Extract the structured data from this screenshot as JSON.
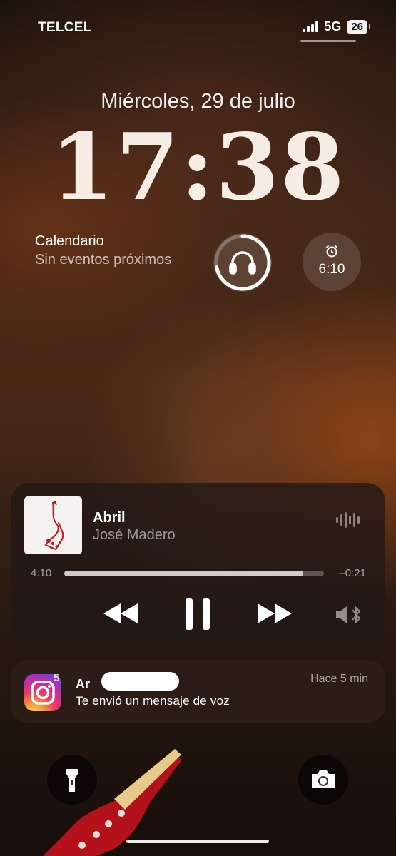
{
  "status": {
    "carrier": "TELCEL",
    "network": "5G",
    "battery": "26"
  },
  "lock": {
    "date": "Miércoles, 29 de julio",
    "time": "17:38"
  },
  "widgets": {
    "calendar_title": "Calendario",
    "calendar_subtitle": "Sin eventos próximos",
    "headphone_battery_fraction": 0.72,
    "alarm_time": "6:10"
  },
  "player": {
    "song": "Abril",
    "artist": "José Madero",
    "elapsed": "4:10",
    "remaining": "–0:21",
    "progress_fraction": 0.92
  },
  "notification": {
    "app_badge": "5",
    "sender": "Ar",
    "time": "Hace 5 min",
    "message": "Te envió un mensaje de voz"
  },
  "icons": {
    "headphones": "headphones-icon",
    "alarm": "alarm-icon",
    "rewind": "rewind-icon",
    "pause": "pause-icon",
    "forward": "fast-forward-icon",
    "output": "speaker-bluetooth-icon",
    "flashlight": "flashlight-icon",
    "camera": "camera-icon"
  }
}
